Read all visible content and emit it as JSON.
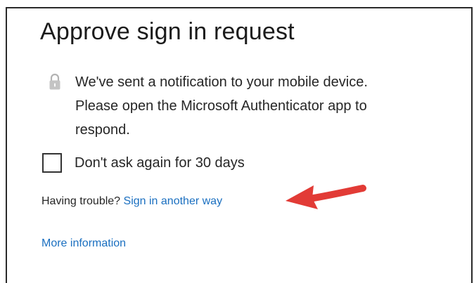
{
  "dialog": {
    "title": "Approve sign in request",
    "notice_line1": "We've sent a notification to your mobile device.",
    "notice_line2": "Please open the Microsoft Authenticator app to",
    "notice_line3": "respond.",
    "checkbox_label": "Don't ask again for 30 days",
    "checkbox_checked": false,
    "trouble_prefix": "Having trouble?",
    "sign_in_another_way": "Sign in another way",
    "more_information": "More information"
  },
  "icons": {
    "lock": "lock-icon",
    "annotation_arrow": "red-arrow-icon"
  },
  "colors": {
    "link": "#1a6fc0",
    "arrow": "#e23b36",
    "text": "#262626"
  }
}
